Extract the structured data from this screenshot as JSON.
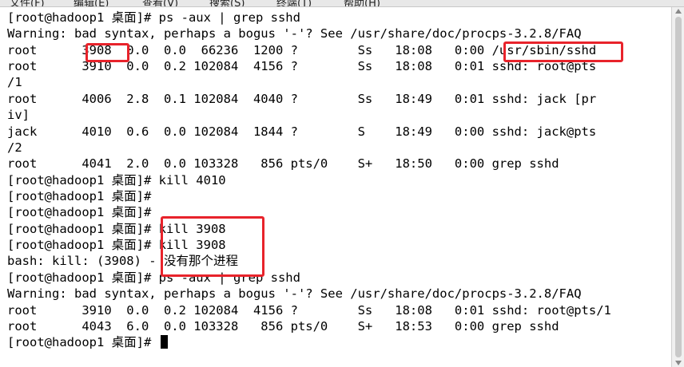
{
  "menubar": {
    "items": [
      "文件(F)",
      "编辑(E)",
      "查看(V)",
      "搜索(S)",
      "终端(T)",
      "帮助(H)"
    ]
  },
  "terminal": {
    "lines": [
      "[root@hadoop1 桌面]# ps -aux | grep sshd",
      "Warning: bad syntax, perhaps a bogus '-'? See /usr/share/doc/procps-3.2.8/FAQ",
      "root      3908  0.0  0.0  66236  1200 ?        Ss   18:08   0:00 /usr/sbin/sshd",
      "root      3910  0.0  0.2 102084  4156 ?        Ss   18:08   0:01 sshd: root@pts",
      "/1",
      "root      4006  2.8  0.1 102084  4040 ?        Ss   18:49   0:01 sshd: jack [pr",
      "iv]",
      "jack      4010  0.6  0.0 102084  1844 ?        S    18:49   0:00 sshd: jack@pts",
      "/2",
      "root      4041  2.0  0.0 103328   856 pts/0    S+   18:50   0:00 grep sshd",
      "[root@hadoop1 桌面]# kill 4010",
      "[root@hadoop1 桌面]#",
      "[root@hadoop1 桌面]#",
      "[root@hadoop1 桌面]# kill 3908",
      "[root@hadoop1 桌面]# kill 3908",
      "bash: kill: (3908) - 没有那个进程",
      "[root@hadoop1 桌面]# ps -aux | grep sshd",
      "Warning: bad syntax, perhaps a bogus '-'? See /usr/share/doc/procps-3.2.8/FAQ",
      "root      3910  0.0  0.2 102084  4156 ?        Ss   18:08   0:01 sshd: root@pts/1",
      "root      4043  6.0  0.0 103328   856 pts/0    S+   18:53   0:00 grep sshd",
      "[root@hadoop1 桌面]# "
    ]
  },
  "highlight_color": "#e8232b"
}
